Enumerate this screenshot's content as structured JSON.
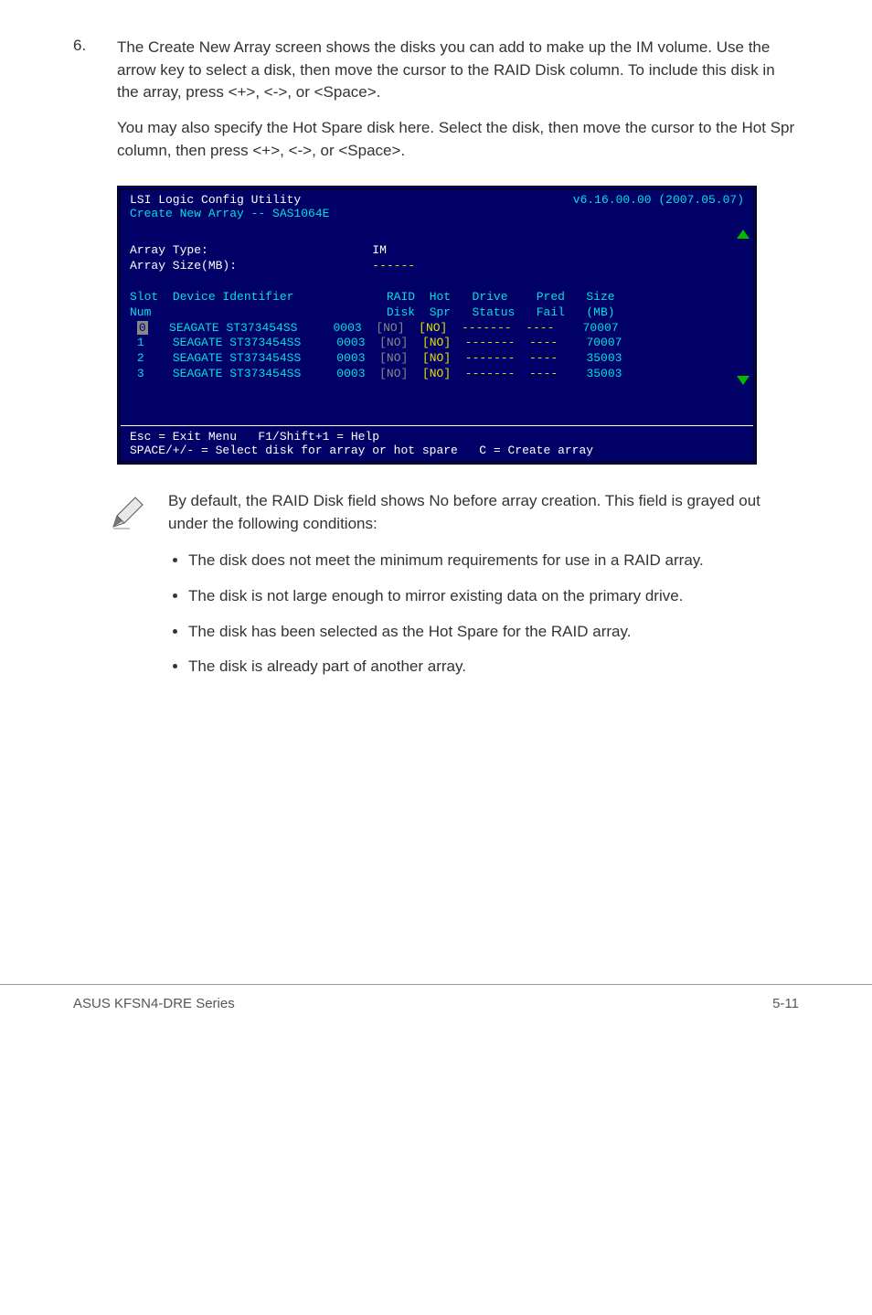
{
  "step": {
    "number": "6.",
    "para1": "The Create New Array screen shows the disks you can add to make up the IM volume. Use the arrow key to select a disk, then move the cursor to the RAID Disk column. To include this disk in the array, press <+>, <->, or <Space>.",
    "para2": "You may also specify the Hot Spare disk here. Select the disk, then move the cursor to the Hot Spr column, then press <+>, <->, or <Space>."
  },
  "terminal": {
    "title_left": "LSI Logic Config Utility",
    "title_right": "v6.16.00.00 (2007.05.07)",
    "subtitle": "Create New Array -- SAS1064E",
    "field_labels": {
      "array_type": "Array Type:",
      "array_size": "Array Size(MB):"
    },
    "values": {
      "array_type": "IM",
      "array_size": "------"
    },
    "headers": {
      "slot": "Slot",
      "num": "Num",
      "dev": "Device Identifier",
      "raid": "RAID",
      "disk": "Disk",
      "hot": "Hot",
      "spr": "Spr",
      "drive": "Drive",
      "status": "Status",
      "pred": "Pred",
      "fail": "Fail",
      "size": "Size",
      "mb": "(MB)"
    },
    "rows": [
      {
        "slot": "0",
        "dev": "SEAGATE ST373454SS",
        "rev": "0003",
        "raid": "[NO]",
        "hot": "[NO]",
        "drive": "-------",
        "pred": "----",
        "size": "70007",
        "selected": true
      },
      {
        "slot": "1",
        "dev": "SEAGATE ST373454SS",
        "rev": "0003",
        "raid": "[NO]",
        "hot": "[NO]",
        "drive": "-------",
        "pred": "----",
        "size": "70007",
        "selected": false
      },
      {
        "slot": "2",
        "dev": "SEAGATE ST373454SS",
        "rev": "0003",
        "raid": "[NO]",
        "hot": "[NO]",
        "drive": "-------",
        "pred": "----",
        "size": "35003",
        "selected": false
      },
      {
        "slot": "3",
        "dev": "SEAGATE ST373454SS",
        "rev": "0003",
        "raid": "[NO]",
        "hot": "[NO]",
        "drive": "-------",
        "pred": "----",
        "size": "35003",
        "selected": false
      }
    ],
    "footer1": "Esc = Exit Menu   F1/Shift+1 = Help",
    "footer2": "SPACE/+/- = Select disk for array or hot spare   C = Create array"
  },
  "note": {
    "intro": "By default, the RAID Disk field shows No before array creation. This field is grayed out under the following conditions:",
    "bullets": [
      "The disk does not meet the  minimum requirements for use in a RAID array.",
      "The disk is not large enough to mirror existing data on the primary drive.",
      "The disk has been selected as the Hot Spare for the RAID array.",
      "The disk is already part of another array."
    ]
  },
  "footer": {
    "left": "ASUS KFSN4-DRE Series",
    "right": "5-11"
  }
}
